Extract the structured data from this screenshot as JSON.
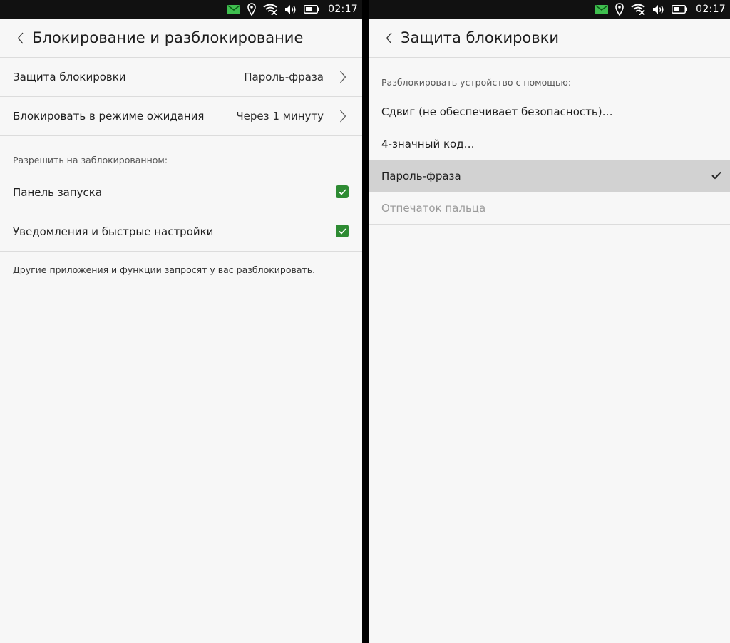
{
  "status_bar": {
    "time": "02:17",
    "icons": [
      "mail-icon",
      "location-icon",
      "wifi-icon",
      "volume-icon",
      "battery-icon"
    ],
    "mail_color": "#3fbf4f"
  },
  "left": {
    "title": "Блокирование и разблокирование",
    "rows": [
      {
        "label": "Защита блокировки",
        "value": "Пароль-фраза"
      },
      {
        "label": "Блокировать в режиме ожидания",
        "value": "Через 1 минуту"
      }
    ],
    "allow_caption": "Разрешить на заблокированном:",
    "toggles": [
      {
        "label": "Панель запуска",
        "checked": true
      },
      {
        "label": "Уведомления и быстрые настройки",
        "checked": true
      }
    ],
    "footnote": "Другие приложения и функции запросят у вас разблокировать.",
    "accent": "#2e8b33"
  },
  "right": {
    "title": "Защита блокировки",
    "caption": "Разблокировать устройство с помощью:",
    "options": [
      {
        "label": "Сдвиг (не обеспечивает безопасность)…",
        "selected": false,
        "enabled": true
      },
      {
        "label": "4-значный код…",
        "selected": false,
        "enabled": true
      },
      {
        "label": "Пароль-фраза",
        "selected": true,
        "enabled": true
      },
      {
        "label": "Отпечаток пальца",
        "selected": false,
        "enabled": false
      }
    ]
  }
}
